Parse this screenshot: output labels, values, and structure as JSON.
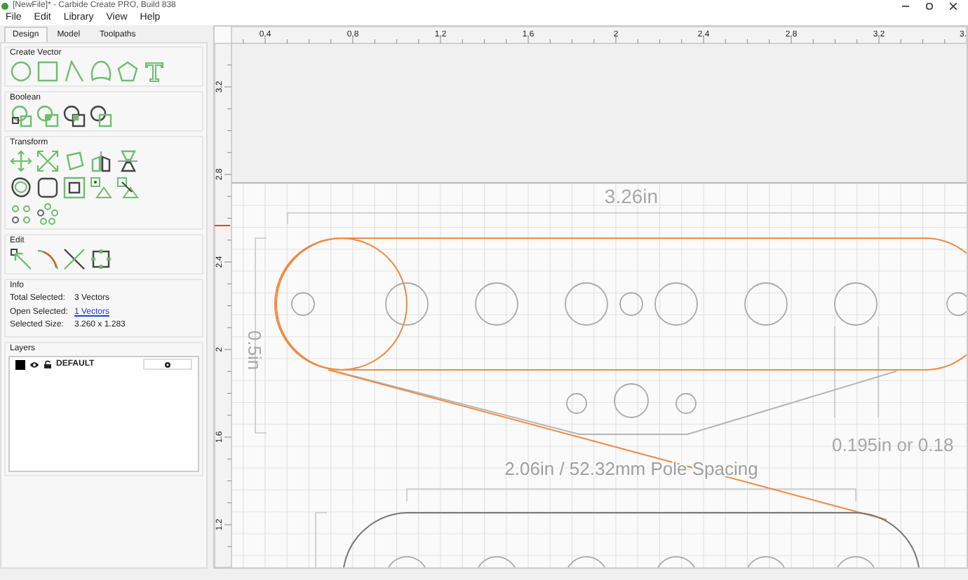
{
  "window": {
    "title": "[NewFile]* - Carbide Create PRO, Build 838"
  },
  "menu": [
    {
      "label": "File"
    },
    {
      "label": "Edit"
    },
    {
      "label": "Library"
    },
    {
      "label": "View"
    },
    {
      "label": "Help"
    }
  ],
  "tabs": [
    {
      "label": "Design",
      "selected": true
    },
    {
      "label": "Model",
      "selected": false
    },
    {
      "label": "Toolpaths",
      "selected": false
    }
  ],
  "sections": {
    "create_vector": "Create Vector",
    "boolean": "Boolean",
    "transform": "Transform",
    "edit": "Edit",
    "info": "Info",
    "layers": "Layers"
  },
  "info": [
    {
      "label": "Total Selected:",
      "value": "3 Vectors",
      "kind": "text"
    },
    {
      "label": "Open Selected:",
      "value": "1 Vectors",
      "kind": "link"
    },
    {
      "label": "Selected Size:",
      "value": "3.260 x 1.283",
      "kind": "text"
    }
  ],
  "layers": [
    {
      "name": "DEFAULT",
      "color": "#000000"
    }
  ],
  "rulers": {
    "x_ticks": [
      "0.4",
      "0.8",
      "1.2",
      "1.6",
      "2",
      "2.4",
      "2.8",
      "3.2",
      "3."
    ],
    "y_ticks": [
      "3.2",
      "2.8",
      "2.4",
      "2",
      "1.6",
      "1.2"
    ]
  },
  "canvas": {
    "width_dimension": "3.26in",
    "height_dimension": "0.5in",
    "spacing_note": "2.06in / 52.32mm Pole Spacing",
    "hole_note": "0.195in or 0.18"
  }
}
